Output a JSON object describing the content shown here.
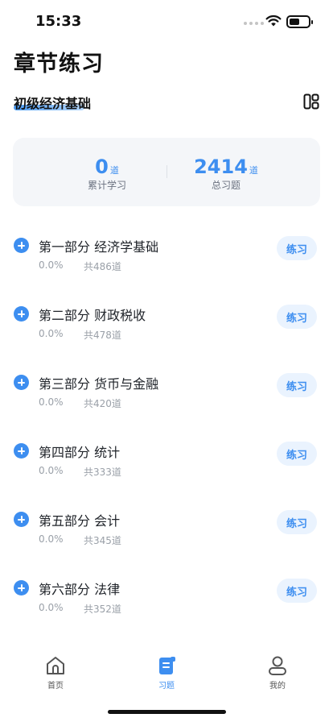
{
  "status_bar": {
    "time": "15:33"
  },
  "header": {
    "title": "章节练习"
  },
  "subject": {
    "label": "初级经济基础"
  },
  "stats": {
    "learned": {
      "value": "0",
      "unit": "道",
      "label": "累计学习"
    },
    "total": {
      "value": "2414",
      "unit": "道",
      "label": "总习题"
    }
  },
  "chapters": [
    {
      "title": "第一部分 经济学基础",
      "progress": "0.0%",
      "count": "共486道",
      "button": "练习"
    },
    {
      "title": "第二部分 财政税收",
      "progress": "0.0%",
      "count": "共478道",
      "button": "练习"
    },
    {
      "title": "第三部分 货币与金融",
      "progress": "0.0%",
      "count": "共420道",
      "button": "练习"
    },
    {
      "title": "第四部分 统计",
      "progress": "0.0%",
      "count": "共333道",
      "button": "练习"
    },
    {
      "title": "第五部分 会计",
      "progress": "0.0%",
      "count": "共345道",
      "button": "练习"
    },
    {
      "title": "第六部分 法律",
      "progress": "0.0%",
      "count": "共352道",
      "button": "练习"
    }
  ],
  "tabs": [
    {
      "label": "首页",
      "icon": "home-icon"
    },
    {
      "label": "习题",
      "icon": "exercise-icon",
      "active": true
    },
    {
      "label": "我的",
      "icon": "profile-icon"
    }
  ],
  "colors": {
    "accent": "#3d8ef0",
    "accent_light": "#eaf3fe",
    "card_bg": "#f4f6f9"
  }
}
